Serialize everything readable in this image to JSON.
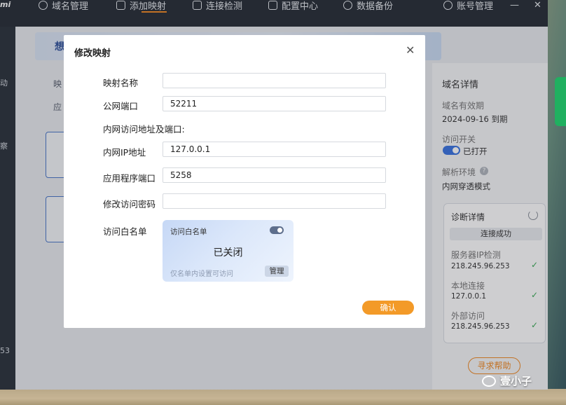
{
  "topnav": {
    "logo": "mi",
    "items": [
      {
        "label": "域名管理"
      },
      {
        "label": "添加映射"
      },
      {
        "label": "连接检测"
      },
      {
        "label": "配置中心"
      },
      {
        "label": "数据备份"
      }
    ],
    "account": "账号管理",
    "minimize": "—",
    "close": "✕"
  },
  "leftbar": {
    "texts": [
      "动",
      "察",
      "53"
    ]
  },
  "background": {
    "banner_text": "想",
    "labels": [
      "映",
      "应"
    ]
  },
  "right_panel": {
    "title": "域名详情",
    "validity_label": "域名有效期",
    "validity_value": "2024-09-16 到期",
    "access_label": "访问开关",
    "access_value": "已打开",
    "env_label": "解析环境",
    "env_help": "?",
    "env_value": "内网穿透模式",
    "diag": {
      "title": "诊断详情",
      "status": "连接成功",
      "items": [
        {
          "label": "服务器IP检测",
          "value": "218.245.96.253"
        },
        {
          "label": "本地连接",
          "value": "127.0.0.1"
        },
        {
          "label": "外部访问",
          "value": "218.245.96.253"
        }
      ]
    },
    "help_button": "寻求帮助"
  },
  "modal": {
    "title": "修改映射",
    "close": "✕",
    "fields": {
      "name_label": "映射名称",
      "name_value": "",
      "port_label": "公网端口",
      "port_value": "52211",
      "section_label": "内网访问地址及端口:",
      "ip_label": "内网IP地址",
      "ip_value": "127.0.0.1",
      "app_port_label": "应用程序端口",
      "app_port_value": "5258",
      "password_label": "修改访问密码",
      "password_value": "",
      "whitelist_label": "访问白名单"
    },
    "whitelist": {
      "header": "访问白名单",
      "status": "已关闭",
      "hint": "仅名单内设置可访问",
      "manage_button": "管理"
    },
    "confirm_button": "确认"
  },
  "watermark": {
    "text": "壹小子"
  },
  "colors": {
    "accent": "#f39a28",
    "toggle_on": "#3a74e0",
    "check": "#3aaa55"
  }
}
